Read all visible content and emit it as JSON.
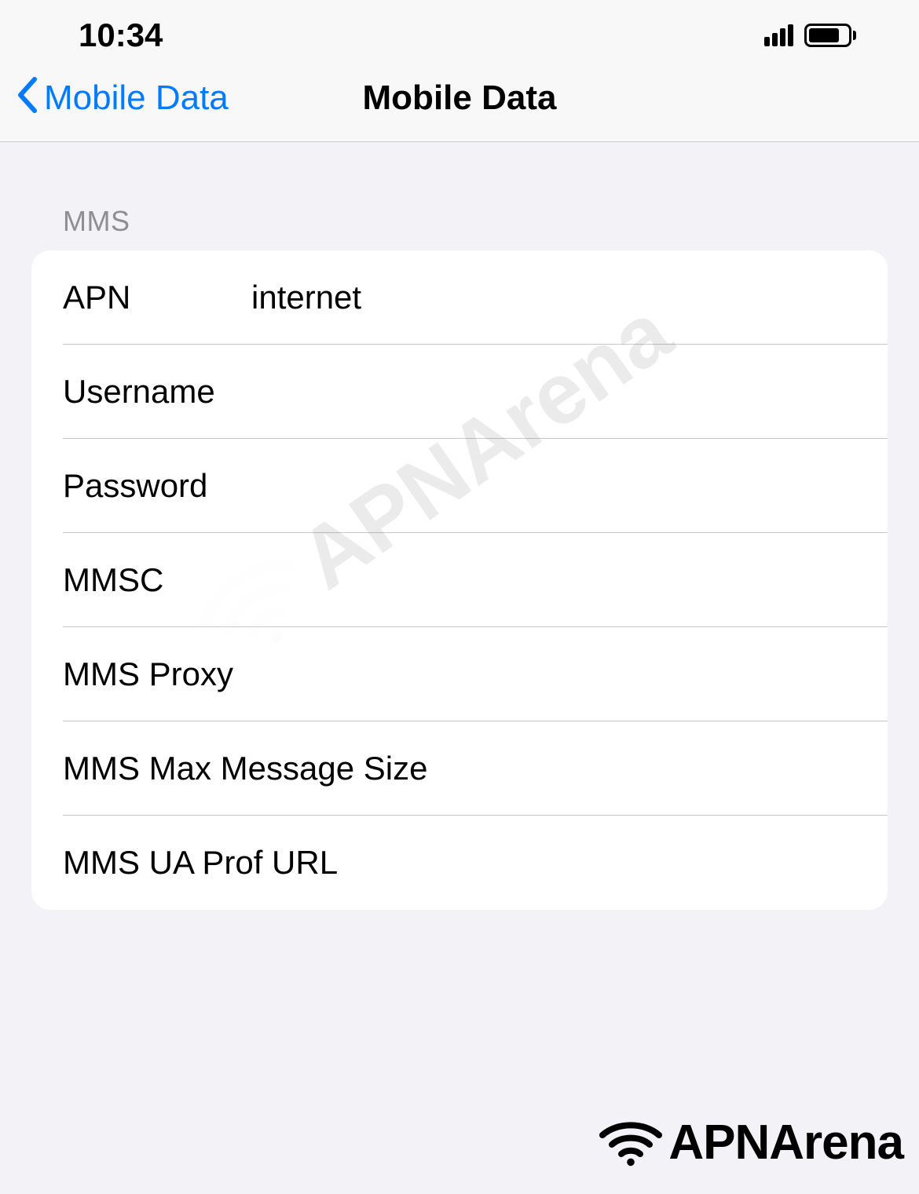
{
  "status_bar": {
    "time": "10:34"
  },
  "nav": {
    "back_label": "Mobile Data",
    "title": "Mobile Data"
  },
  "section": {
    "header": "MMS",
    "rows": [
      {
        "label": "APN",
        "value": "internet"
      },
      {
        "label": "Username",
        "value": ""
      },
      {
        "label": "Password",
        "value": ""
      },
      {
        "label": "MMSC",
        "value": ""
      },
      {
        "label": "MMS Proxy",
        "value": ""
      },
      {
        "label": "MMS Max Message Size",
        "value": ""
      },
      {
        "label": "MMS UA Prof URL",
        "value": ""
      }
    ]
  },
  "watermark": {
    "text": "APNArena",
    "logo_text": "APNArena"
  }
}
